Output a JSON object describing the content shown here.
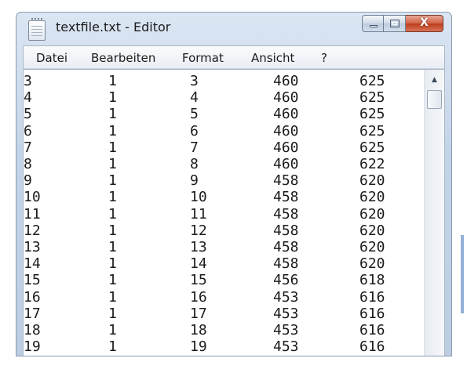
{
  "window": {
    "title": "textfile.txt - Editor",
    "close_glyph": "X",
    "icons": {
      "app": "notepad-icon",
      "minimize": "minimize-icon",
      "maximize": "maximize-icon",
      "close": "close-icon",
      "scroll_up": "scroll-up-arrow-icon"
    }
  },
  "menu": {
    "items": [
      {
        "label": "Datei"
      },
      {
        "label": "Bearbeiten"
      },
      {
        "label": "Format"
      },
      {
        "label": "Ansicht"
      },
      {
        "label": "?"
      }
    ]
  },
  "rows": [
    [
      "3",
      "1",
      "3",
      "460",
      "625"
    ],
    [
      "4",
      "1",
      "4",
      "460",
      "625"
    ],
    [
      "5",
      "1",
      "5",
      "460",
      "625"
    ],
    [
      "6",
      "1",
      "6",
      "460",
      "625"
    ],
    [
      "7",
      "1",
      "7",
      "460",
      "625"
    ],
    [
      "8",
      "1",
      "8",
      "460",
      "622"
    ],
    [
      "9",
      "1",
      "9",
      "458",
      "620"
    ],
    [
      "10",
      "1",
      "10",
      "458",
      "620"
    ],
    [
      "11",
      "1",
      "11",
      "458",
      "620"
    ],
    [
      "12",
      "1",
      "12",
      "458",
      "620"
    ],
    [
      "13",
      "1",
      "13",
      "458",
      "620"
    ],
    [
      "14",
      "1",
      "14",
      "458",
      "620"
    ],
    [
      "15",
      "1",
      "15",
      "456",
      "618"
    ],
    [
      "16",
      "1",
      "16",
      "453",
      "616"
    ],
    [
      "17",
      "1",
      "17",
      "453",
      "616"
    ],
    [
      "18",
      "1",
      "18",
      "453",
      "616"
    ],
    [
      "19",
      "1",
      "19",
      "453",
      "616"
    ]
  ]
}
